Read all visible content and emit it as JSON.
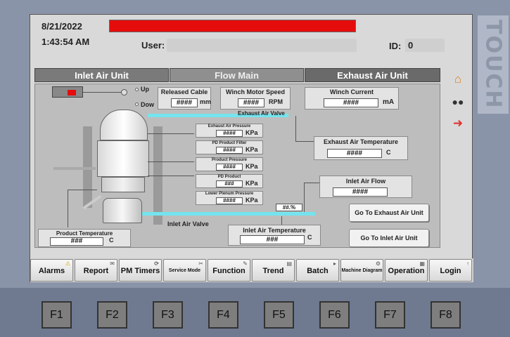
{
  "header": {
    "date": "8/21/2022",
    "time": "1:43:54 AM",
    "user_label": "User:",
    "id_label": "ID:",
    "id_value": "0"
  },
  "brand": "TOUCH",
  "tabs": [
    {
      "label": "Inlet Air Unit"
    },
    {
      "label": "Flow Main"
    },
    {
      "label": "Exhaust Air Unit"
    }
  ],
  "process": {
    "up_label": "Up",
    "down_label": "Dow",
    "released_cable": {
      "title": "Released Cable",
      "value": "####",
      "unit": "mm"
    },
    "winch_motor_speed": {
      "title": "Winch Motor Speed",
      "value": "####",
      "unit": "RPM"
    },
    "winch_current": {
      "title": "Winch Current",
      "value": "####",
      "unit": "mA"
    },
    "exhaust_air_valve": "Exhaust Air Valve",
    "exhaust_air_pressure": {
      "title": "Exhaust Air Pressure",
      "value": "####",
      "unit": "KPa"
    },
    "pd_product_filter": {
      "title": "PD Product Filter",
      "value": "####",
      "unit": "KPa"
    },
    "product_pressure": {
      "title": "Product Pressure",
      "value": "####",
      "unit": "KPa"
    },
    "pd_product": {
      "title": "PD Product",
      "value": "###",
      "unit": "KPa"
    },
    "lower_plenum_pressure": {
      "title": "Lower Plenum Pressure",
      "value": "####",
      "unit": "KPa"
    },
    "exhaust_air_temperature": {
      "title": "Exhaust Air Temperature",
      "value": "####",
      "unit": "C"
    },
    "inlet_air_flow": {
      "title": "Inlet Air Flow",
      "value": "####"
    },
    "valve_percent": "##.%",
    "inlet_air_valve": "Inlet Air Valve",
    "inlet_air_temperature": {
      "title": "Inlet Air Temperature",
      "value": "###",
      "unit": "C"
    },
    "product_temperature": {
      "title": "Product Temperature",
      "value": "###",
      "unit": "C"
    },
    "goto_exhaust": "Go To Exhaust Air Unit",
    "goto_inlet": "Go To Inlet Air Unit"
  },
  "side_icons": [
    "home-icon",
    "users-icon",
    "logout-icon"
  ],
  "function_bar": [
    {
      "label": "Alarms",
      "icon": "⚠"
    },
    {
      "label": "Report",
      "icon": "✉"
    },
    {
      "label": "PM Timers",
      "icon": "⟳"
    },
    {
      "label": "Service Mode",
      "icon": "✂"
    },
    {
      "label": "Function",
      "icon": "✎"
    },
    {
      "label": "Trend",
      "icon": "▤"
    },
    {
      "label": "Batch",
      "icon": "▸"
    },
    {
      "label": "Machine Diagram",
      "icon": "⚙"
    },
    {
      "label": "Operation",
      "icon": "▦"
    },
    {
      "label": "Login",
      "icon": "↑"
    }
  ],
  "hardware_keys": [
    "F1",
    "F2",
    "F3",
    "F4",
    "F5",
    "F6",
    "F7",
    "F8"
  ],
  "colors": {
    "alarm_bar": "#e50c0c",
    "pipe_cyan": "#74e4ef"
  }
}
